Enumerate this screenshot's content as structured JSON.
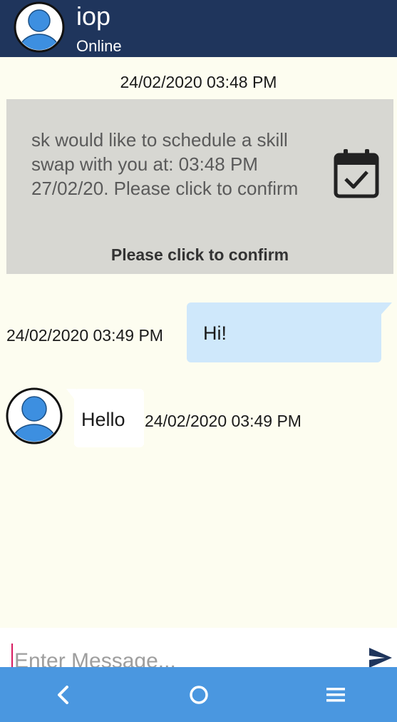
{
  "header": {
    "contact_name": "iop",
    "status": "Online",
    "avatar_icon": "user-avatar-icon"
  },
  "messages": {
    "schedule": {
      "timestamp": "24/02/2020 03:48 PM",
      "text": "sk would like to schedule a skill swap with you at: 03:48 PM 27/02/20. Please click to confirm",
      "confirm_label": "Please click to confirm",
      "icon": "calendar-check-icon"
    },
    "sent": {
      "timestamp": "24/02/2020 03:49 PM",
      "text": "Hi!"
    },
    "received": {
      "timestamp": "24/02/2020 03:49 PM",
      "text": "Hello"
    }
  },
  "composer": {
    "placeholder": "Enter Message...",
    "value": "",
    "send_icon": "send-icon"
  },
  "nav": {
    "back_icon": "back-icon",
    "home_icon": "home-icon",
    "menu_icon": "menu-icon"
  },
  "colors": {
    "header_bg": "#1f355c",
    "page_bg": "#fdfdf0",
    "schedule_card_bg": "#d7d7d2",
    "sent_bubble_bg": "#cfe8fb",
    "nav_bar_bg": "#4a97e0",
    "avatar_blue": "#3d8fe0"
  }
}
